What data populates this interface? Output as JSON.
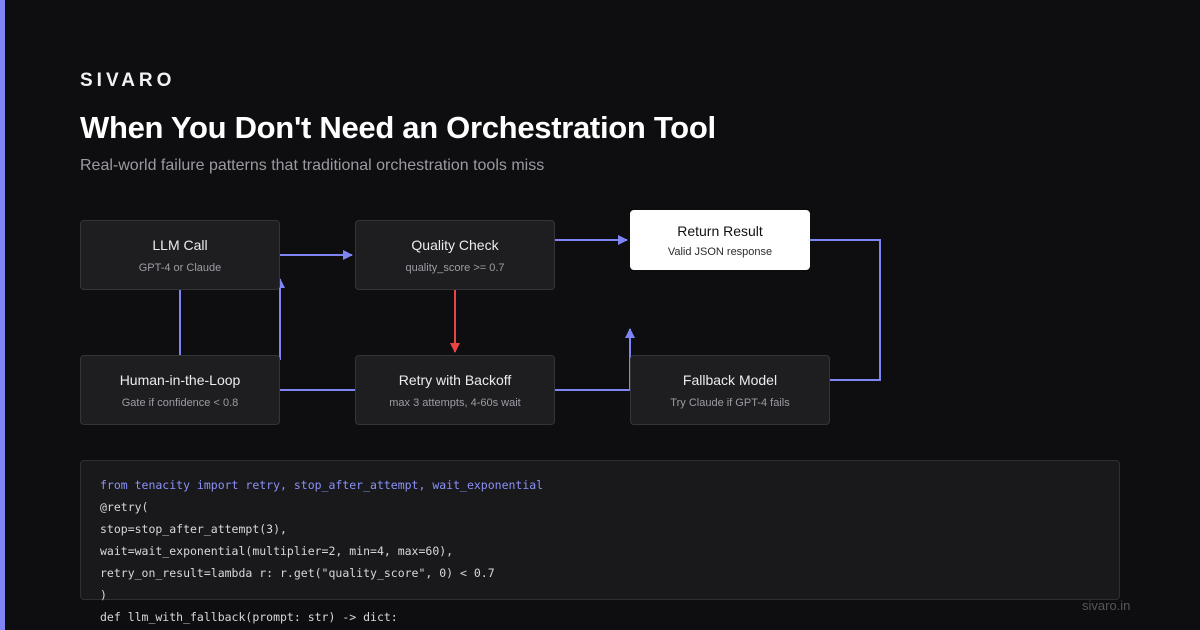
{
  "brand": "SIVARO",
  "title": "When You Don't Need an Orchestration Tool",
  "subtitle": "Real-world failure patterns that traditional orchestration tools miss",
  "colors": {
    "background": "#0e0e10",
    "accent": "#7f85f5",
    "edge": "#7f85f5",
    "retry_edge": "#e84545",
    "node_fill": "#1e1e21",
    "result_fill": "#ffffff"
  },
  "diagram": {
    "nodes": {
      "llm_call": {
        "label": "LLM Call",
        "sub": "GPT-4 or Claude"
      },
      "quality_check": {
        "label": "Quality Check",
        "sub": "quality_score >= 0.7"
      },
      "return_result": {
        "label": "Return Result",
        "sub": "Valid JSON response"
      },
      "human_loop": {
        "label": "Human-in-the-Loop",
        "sub": "Gate if confidence < 0.8"
      },
      "retry_backoff": {
        "label": "Retry with Backoff",
        "sub": "max 3 attempts, 4-60s wait"
      },
      "fallback_model": {
        "label": "Fallback Model",
        "sub": "Try Claude if GPT-4 fails"
      }
    },
    "edges": [
      {
        "from": "llm_call",
        "to": "quality_check",
        "color": "accent"
      },
      {
        "from": "quality_check",
        "to": "return_result",
        "color": "accent"
      },
      {
        "from": "quality_check",
        "to": "retry_backoff",
        "color": "red"
      },
      {
        "from": "llm_call",
        "to": "human_loop",
        "color": "accent"
      },
      {
        "from": "human_loop",
        "to": "llm_call",
        "color": "accent"
      },
      {
        "from": "retry_backoff",
        "to": "return_result",
        "color": "accent"
      },
      {
        "from": "fallback_model",
        "to": "return_result",
        "color": "accent"
      }
    ]
  },
  "code": {
    "lines": [
      "from tenacity import retry, stop_after_attempt, wait_exponential",
      "@retry(",
      "stop=stop_after_attempt(3),",
      "wait=wait_exponential(multiplier=2, min=4, max=60),",
      "retry_on_result=lambda r: r.get(\"quality_score\", 0) < 0.7",
      ")",
      "def llm_with_fallback(prompt: str) -> dict:"
    ]
  },
  "footer": {
    "url": "sivaro.in"
  }
}
